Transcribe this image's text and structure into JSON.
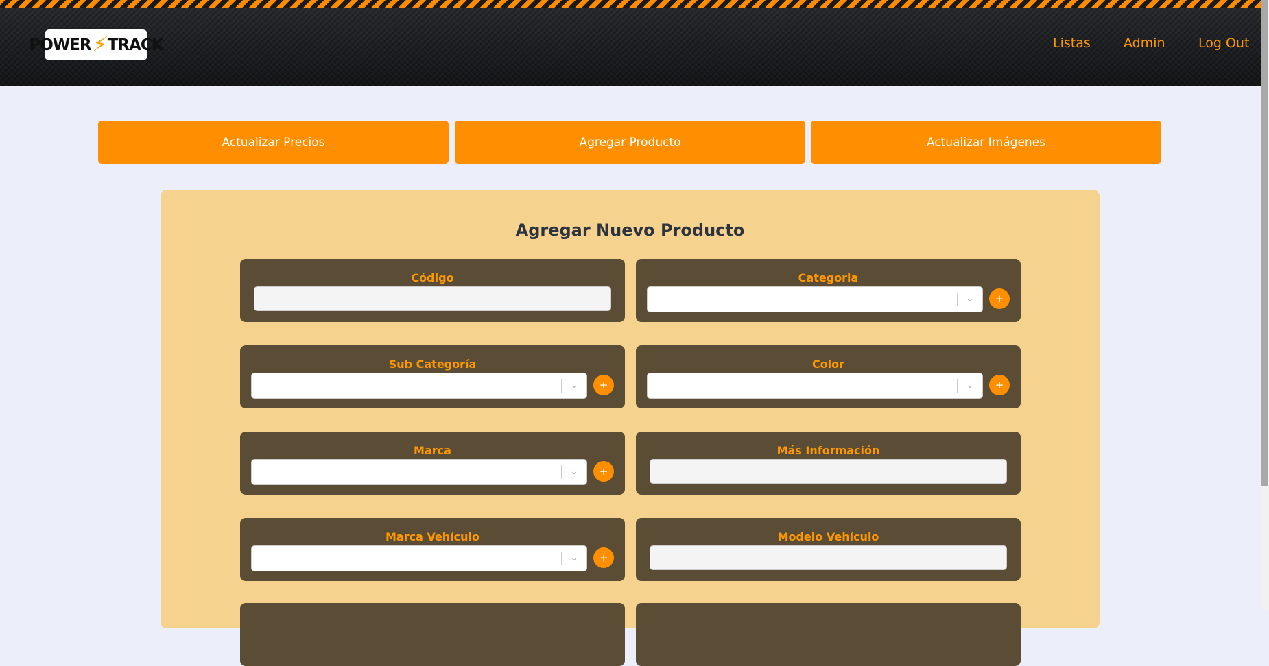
{
  "header": {
    "logo_text_left": "POWER",
    "logo_text_right": "TRACK",
    "nav": [
      "Listas",
      "Admin",
      "Log Out"
    ]
  },
  "actions": [
    "Actualizar Precios",
    "Agregar Producto",
    "Actualizar Imágenes"
  ],
  "form": {
    "title": "Agregar Nuevo Producto",
    "fields": [
      {
        "label": "Código",
        "type": "text",
        "value": ""
      },
      {
        "label": "Categoria",
        "type": "select",
        "value": ""
      },
      {
        "label": "Sub Categoría",
        "type": "select",
        "value": ""
      },
      {
        "label": "Color",
        "type": "select",
        "value": ""
      },
      {
        "label": "Marca",
        "type": "select",
        "value": ""
      },
      {
        "label": "Más Información",
        "type": "text",
        "value": ""
      },
      {
        "label": "Marca Vehículo",
        "type": "select",
        "value": ""
      },
      {
        "label": "Modelo Vehículo",
        "type": "text",
        "value": ""
      }
    ],
    "add_button_symbol": "+"
  },
  "colors": {
    "accent": "#ff8f00",
    "background": "#eceefa",
    "panel": "#f6d28f",
    "field_card": "#5b4d35",
    "title": "#2d3440"
  },
  "icons": {
    "select_indicator": "chevron-down-icon",
    "add": "plus-icon"
  }
}
